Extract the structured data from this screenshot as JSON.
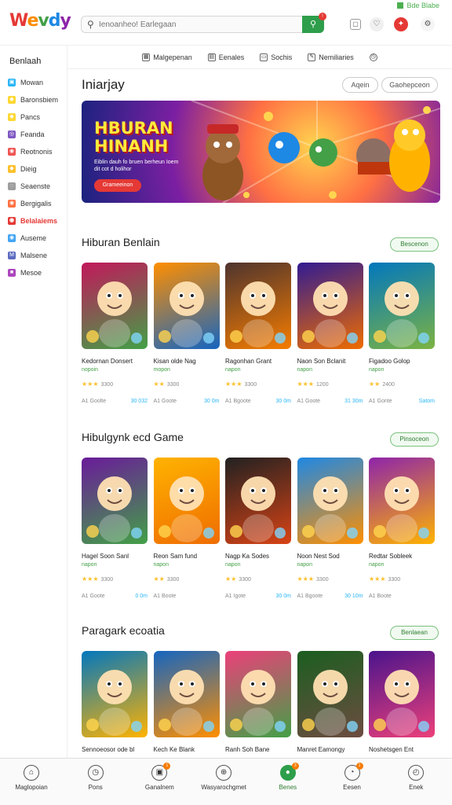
{
  "app": {
    "logo": "Wevdy",
    "status_text": "Bde Blabe"
  },
  "search": {
    "placeholder": "Ienoanheo! Earlegaan",
    "value": ""
  },
  "subnav": [
    {
      "label": "Malgepenan",
      "icon": "grid-icon"
    },
    {
      "label": "Eenales",
      "icon": "chart-icon"
    },
    {
      "label": "Sochis",
      "icon": "chat-icon"
    },
    {
      "label": "Nemiliaries",
      "icon": "edit-icon"
    },
    {
      "label": "",
      "icon": "clock-icon"
    }
  ],
  "sidebar": {
    "title": "Benlaah",
    "items": [
      {
        "label": "Mowan",
        "color": "#29b6f6"
      },
      {
        "label": "Baronsbiem",
        "color": "#fdd835"
      },
      {
        "label": "Pancs",
        "color": "#fdd835"
      },
      {
        "label": "Feanda",
        "color": "#7e57c2"
      },
      {
        "label": "Reotnonis",
        "color": "#ef5350"
      },
      {
        "label": "Dieig",
        "color": "#fbc02d"
      },
      {
        "label": "Seaenste",
        "color": "#9e9e9e"
      },
      {
        "label": "Bergigalis",
        "color": "#ff7043"
      },
      {
        "label": "Belalaiems",
        "color": "#e53935",
        "active": true
      },
      {
        "label": "Auseme",
        "color": "#42a5f5"
      },
      {
        "label": "Malsene",
        "color": "#5c6bc0"
      },
      {
        "label": "Mesoe",
        "color": "#ab47bc"
      }
    ]
  },
  "hero": {
    "title": "Iniarjay",
    "btn1": "Aqein",
    "btn2": "Gaohepceon",
    "banner_title_1": "HBURAN",
    "banner_title_2": "HINANH",
    "banner_sub": "Eiblin dauh fo bruen berheun Ioem dit cot d holihor",
    "banner_btn": "Grameeinon"
  },
  "sections": [
    {
      "title": "Hiburan Benlain",
      "button": "Bescenon",
      "cards": [
        {
          "name": "Kedornan Donsert",
          "tag": "nopoin",
          "stars": "★★★",
          "rating": "3300",
          "players": "A1 Goolte",
          "size": "30 032",
          "colors": [
            "#c2185b",
            "#43a047"
          ]
        },
        {
          "name": "Kisan olde Nag",
          "tag": "mopon",
          "stars": "★★",
          "rating": "3300",
          "players": "A1 Goote",
          "size": "30 0m",
          "colors": [
            "#ff8f00",
            "#1565c0"
          ]
        },
        {
          "name": "Ragonhan Grant",
          "tag": "napon",
          "stars": "★★★",
          "rating": "3300",
          "players": "A1 Bgoote",
          "size": "30 0m",
          "colors": [
            "#4e342e",
            "#f57c00"
          ]
        },
        {
          "name": "Naon Son Bclanit",
          "tag": "napon",
          "stars": "★★★",
          "rating": "1200",
          "players": "A1 Goote",
          "size": "31 30m",
          "colors": [
            "#311b92",
            "#ef6c00"
          ]
        },
        {
          "name": "Figadoo Golop",
          "tag": "napon",
          "stars": "★★",
          "rating": "2400",
          "players": "A1 Gonte",
          "size": "Satom",
          "colors": [
            "#0277bd",
            "#7cb342"
          ]
        }
      ]
    },
    {
      "title": "Hibulgynk ecd Game",
      "button": "Pinsoceon",
      "cards": [
        {
          "name": "Hagel Soon Sanl",
          "tag": "napon",
          "stars": "★★★",
          "rating": "3300",
          "players": "A1 Goote",
          "size": "0 0m",
          "colors": [
            "#6a1b9a",
            "#43a047"
          ]
        },
        {
          "name": "Reon Sam fund",
          "tag": "napon",
          "stars": "★★",
          "rating": "3300",
          "players": "A1 Boote",
          "size": "",
          "colors": [
            "#ffb300",
            "#ef6c00"
          ]
        },
        {
          "name": "Nagp Ka Sodes",
          "tag": "napon",
          "stars": "★★",
          "rating": "3300",
          "players": "A1 Igote",
          "size": "30 0m",
          "colors": [
            "#212121",
            "#d84315"
          ]
        },
        {
          "name": "Noon Nest Sod",
          "tag": "napon",
          "stars": "★★★",
          "rating": "3300",
          "players": "A1 Bgoote",
          "size": "30 10m",
          "colors": [
            "#1e88e5",
            "#ff8f00"
          ]
        },
        {
          "name": "Redtar Sobleek",
          "tag": "napon",
          "stars": "★★★",
          "rating": "3300",
          "players": "A1 Boote",
          "size": "",
          "colors": [
            "#8e24aa",
            "#ffb300"
          ]
        }
      ]
    },
    {
      "title": "Paragark ecoatia",
      "button": "Benlaean",
      "cards": [
        {
          "name": "Sennoeosor ode bl",
          "tag": "",
          "stars": "",
          "rating": "",
          "players": "",
          "size": "",
          "colors": [
            "#0277bd",
            "#ffb300"
          ]
        },
        {
          "name": "Kech Ke Blank",
          "tag": "",
          "stars": "",
          "rating": "",
          "players": "",
          "size": "",
          "colors": [
            "#1565c0",
            "#ff8f00"
          ]
        },
        {
          "name": "Ranh Soh Bane",
          "tag": "",
          "stars": "",
          "rating": "",
          "players": "",
          "size": "",
          "colors": [
            "#ec407a",
            "#43a047"
          ]
        },
        {
          "name": "Manret Eamongy",
          "tag": "",
          "stars": "",
          "rating": "",
          "players": "",
          "size": "",
          "colors": [
            "#1b5e20",
            "#6d4c41"
          ]
        },
        {
          "name": "Noshetsgen Ent",
          "tag": "",
          "stars": "",
          "rating": "",
          "players": "",
          "size": "",
          "colors": [
            "#4a148c",
            "#ec407a"
          ]
        }
      ]
    }
  ],
  "bottom_nav": [
    {
      "label": "Maglopoian",
      "icon": "home-icon"
    },
    {
      "label": "Pons",
      "icon": "clock-icon"
    },
    {
      "label": "Ganalnem",
      "icon": "calendar-icon",
      "badge": "1"
    },
    {
      "label": "Wasyarochgmet",
      "icon": "globe-icon"
    },
    {
      "label": "Benes",
      "icon": "game-icon",
      "badge": "3",
      "active": true
    },
    {
      "label": "Eesen",
      "icon": "compass-icon",
      "badge": "1"
    },
    {
      "label": "Enek",
      "icon": "timer-icon"
    }
  ]
}
